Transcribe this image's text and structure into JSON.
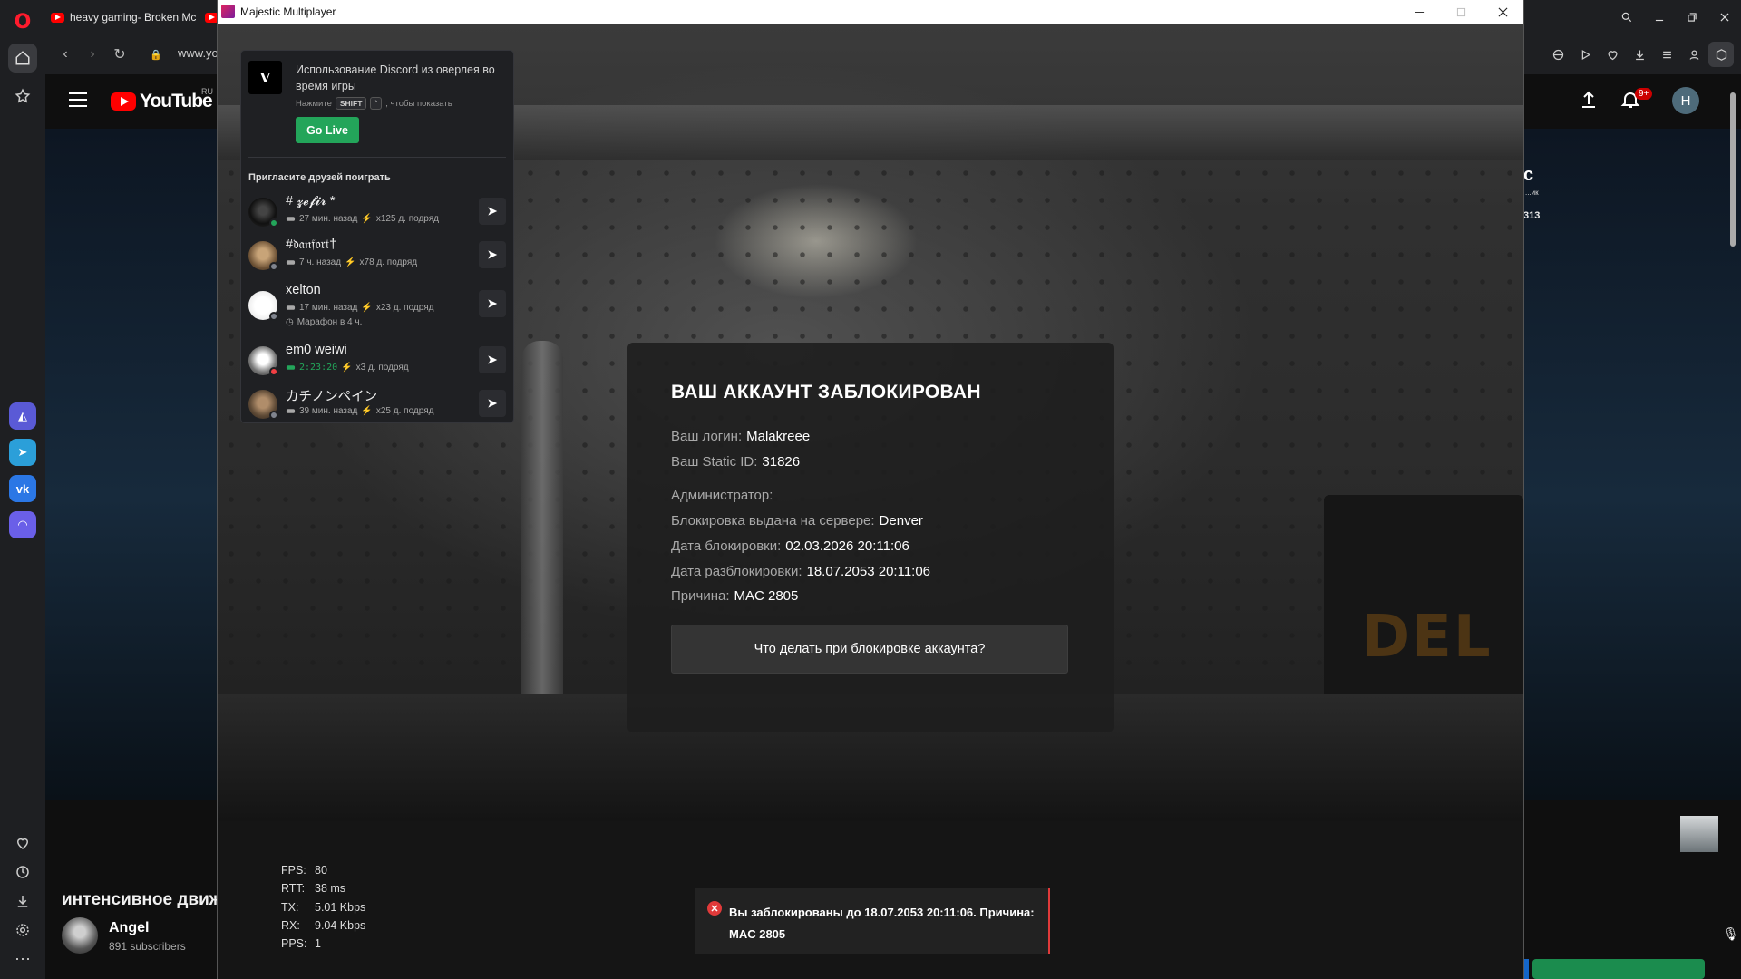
{
  "browser": {
    "tab_title": "heavy gaming- Broken Mc",
    "url": "www.yo",
    "icons": [
      "opera-logo",
      "home-icon",
      "star-icon",
      "aria-icon",
      "telegram-icon",
      "vk-icon",
      "headphones-icon",
      "heart-icon",
      "history-icon",
      "download-icon",
      "settings-icon",
      "more-icon"
    ]
  },
  "youtube": {
    "logo_text": "YouTube",
    "region": "RU",
    "notification_badge": "9+",
    "avatar_letter": "H",
    "video_title": "интенсивное движ",
    "channel_name": "Angel",
    "subscribers": "891 subscribers",
    "side_text_1": "c",
    "side_text_2": "...ик",
    "side_text_3": "313"
  },
  "game_window": {
    "title": "Majestic Multiplayer"
  },
  "ban": {
    "title": "ВАШ АККАУНТ ЗАБЛОКИРОВАН",
    "login_label": "Ваш логин:",
    "login_value": "Malakreee",
    "static_label": "Ваш Static ID:",
    "static_value": "31826",
    "admin_label": "Администратор:",
    "admin_value": "",
    "server_label": "Блокировка выдана на сервере:",
    "server_value": "Denver",
    "ban_date_label": "Дата блокировки:",
    "ban_date_value": "02.03.2026 20:11:06",
    "unban_date_label": "Дата разблокировки:",
    "unban_date_value": "18.07.2053 20:11:06",
    "reason_label": "Причина:",
    "reason_value": "MAC 2805",
    "help_button": "Что делать при блокировке аккаунта?"
  },
  "net_stats": {
    "fps_label": "FPS:",
    "fps_value": "80",
    "rtt_label": "RTT:",
    "rtt_value": "38 ms",
    "tx_label": "TX:",
    "tx_value": "5.01 Kbps",
    "rx_label": "RX:",
    "rx_value": "9.04 Kbps",
    "pps_label": "PPS:",
    "pps_value": "1"
  },
  "toast": {
    "text": "Вы заблокированы до 18.07.2053 20:11:06. Причина: MAC 2805"
  },
  "discord": {
    "overlay_title": "Использование Discord из оверлея во время игры",
    "hint_press": "Нажмите",
    "hint_key1": "SHIFT",
    "hint_key2": "`",
    "hint_suffix": ", чтобы показать",
    "go_live": "Go Live",
    "invite_title": "Пригласите друзей поиграть",
    "friends": [
      {
        "name": "# 𝔃𝓮𝓯𝓲𝓻 *",
        "time": "27 мин. назад",
        "streak": "x125 д. подряд",
        "extra": "",
        "status_color": "#23a55a"
      },
      {
        "name": "#𝔡𝔞𝔫𝔣𝔬𝔯𝔱†",
        "time": "7 ч. назад",
        "streak": "x78 д. подряд",
        "extra": "",
        "status_color": "#80848e"
      },
      {
        "name": "xelton",
        "time": "17 мин. назад",
        "streak": "x23 д. подряд",
        "extra": "Марафон в 4 ч.",
        "status_color": "#80848e"
      },
      {
        "name": "em0 weiwi",
        "time": "2:23:20",
        "streak": "x3 д. подряд",
        "extra": "",
        "status_color": "#f23f43"
      },
      {
        "name": "カチノンペイン",
        "time": "39 мин. назад",
        "streak": "x25 д. подряд",
        "extra": "",
        "status_color": "#80848e"
      }
    ]
  }
}
